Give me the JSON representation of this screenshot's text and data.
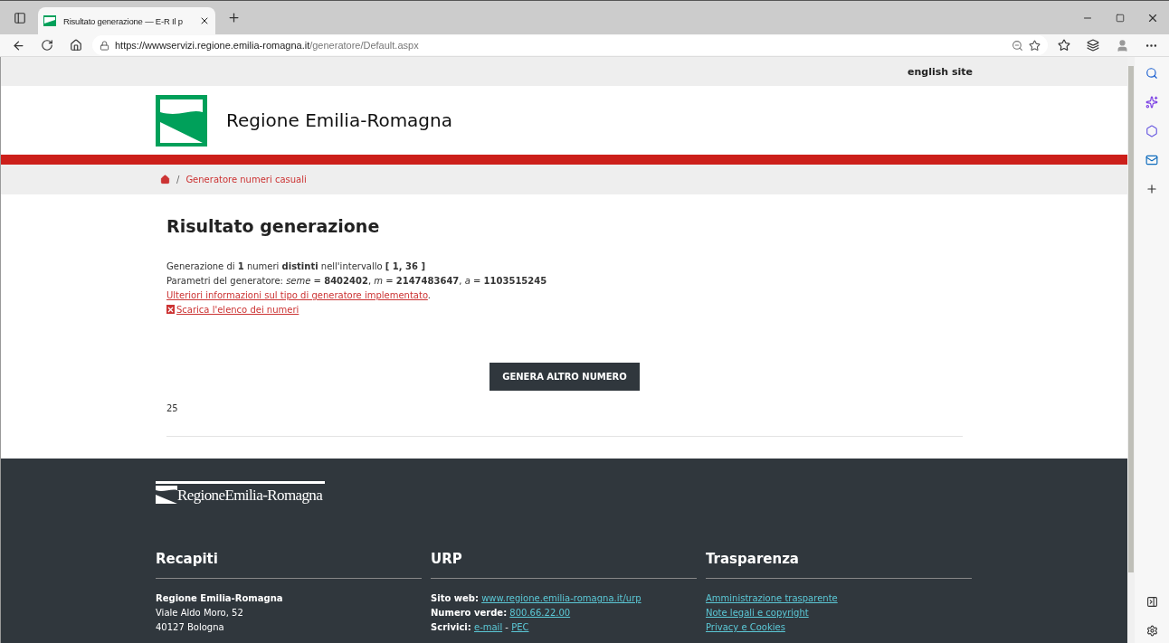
{
  "browser": {
    "tab": {
      "title": "Risultato generazione — E-R Il p",
      "selected": true
    },
    "url_origin": "https://wwwservizi.regione.emilia-romagna.it",
    "url_path": "/generatore/Default.aspx"
  },
  "topbar": {
    "link": "english site"
  },
  "header": {
    "title": "Regione Emilia-Romagna"
  },
  "breadcrumb": {
    "separator": "/",
    "items": [
      "Generatore numeri casuali"
    ]
  },
  "content": {
    "title": "Risultato generazione",
    "lines": [
      {
        "kind": "text",
        "text": "Generazione di **1** numeri **distinti** nell'intervallo **[ 1, 36 ]**"
      },
      {
        "kind": "text",
        "text": "Parametri del generatore: *seme* = **8402402**, *m* = **2147483647**, *a* = **1103515245**"
      },
      {
        "kind": "link",
        "text": "Ulteriori informazioni sul tipo di generatore implementato",
        "suffix": "."
      },
      {
        "kind": "download",
        "text": "Scarica l'elenco dei numeri"
      }
    ],
    "button": "GENERA ALTRO NUMERO",
    "result": "25"
  },
  "footer": {
    "logo": "RegioneEmilia-Romagna",
    "columns": [
      {
        "title": "Recapiti",
        "rows": [
          {
            "kind": "strong",
            "text": "Regione Emilia-Romagna"
          },
          {
            "kind": "text",
            "text": "Viale Aldo Moro, 52"
          },
          {
            "kind": "text",
            "text": "40127 Bologna"
          }
        ]
      },
      {
        "title": "URP",
        "rows": [
          {
            "kind": "labeled",
            "label": "Sito web:",
            "links": [
              "www.regione.emilia-romagna.it/urp"
            ]
          },
          {
            "kind": "labeled",
            "label": "Numero verde:",
            "links": [
              "800.66.22.00"
            ]
          },
          {
            "kind": "labeled",
            "label": "Scrivici:",
            "links": [
              "e-mail",
              "PEC"
            ],
            "separator": "-"
          }
        ]
      },
      {
        "title": "Trasparenza",
        "rows": [
          {
            "kind": "link",
            "text": "Amministrazione trasparente"
          },
          {
            "kind": "link",
            "text": "Note legali e copyright"
          },
          {
            "kind": "link",
            "text": "Privacy e Cookies"
          }
        ]
      }
    ]
  }
}
